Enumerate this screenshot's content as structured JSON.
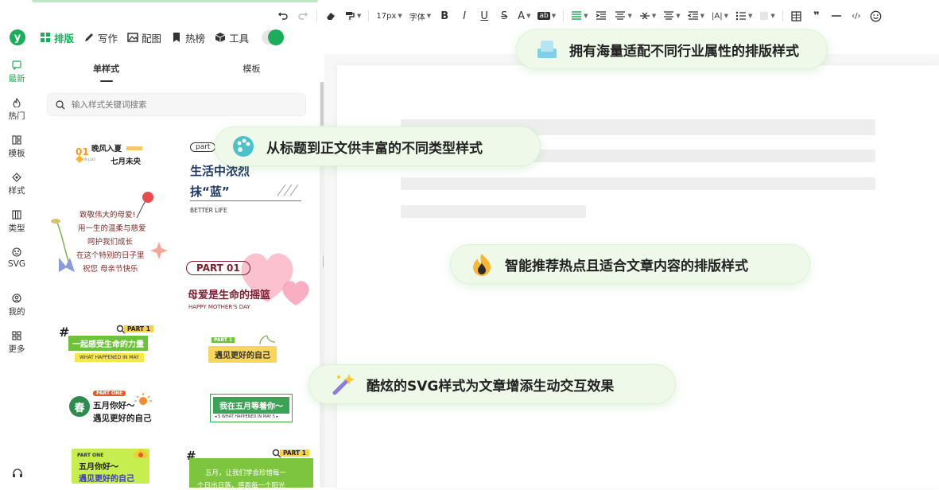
{
  "toolbar": {
    "font_size": "17px",
    "font_family": "字体",
    "bold": "B",
    "italic": "I",
    "underline": "U",
    "strike": "S",
    "font_color": "A",
    "highlight": "ab",
    "letter_spacing": "|A|",
    "quote": "❞",
    "code": "‹/›"
  },
  "main_tabs": [
    {
      "label": "排版"
    },
    {
      "label": "写作"
    },
    {
      "label": "配图"
    },
    {
      "label": "热榜"
    },
    {
      "label": "工具"
    }
  ],
  "rail": [
    {
      "label": "最新"
    },
    {
      "label": "热门"
    },
    {
      "label": "模板"
    },
    {
      "label": "样式"
    },
    {
      "label": "类型"
    },
    {
      "label": "SVG"
    },
    {
      "label": "我的"
    },
    {
      "label": "更多"
    }
  ],
  "panel": {
    "tabs": [
      {
        "label": "单样式"
      },
      {
        "label": "模板"
      }
    ],
    "search_placeholder": "输入样式关键词搜索",
    "styles": {
      "s1": {
        "num": "01",
        "line1": "晚风入夏",
        "line2": "七月未央",
        "tiny": "IN JULY"
      },
      "s2": {
        "tag": "part",
        "line1": "生活中浓烈",
        "line2": "抹“蓝”",
        "sub": "BETTER LIFE"
      },
      "s3": {
        "l1": "致敬伟大的母爱!",
        "l2": "用一生的温柔与慈爱",
        "l3": "呵护我们成长",
        "l4": "在这个特别的日子里",
        "l5": "祝您 母亲节快乐"
      },
      "s4": {
        "tag": "PART 01",
        "title": "母爱是生命的摇篮",
        "sub": "HAPPY MOTHER'S DAY"
      },
      "s5": {
        "hash": "#",
        "tag": "PART 1",
        "title": "一起感受生命的力量",
        "sub": "WHAT HAPPENED IN MAY"
      },
      "s6": {
        "tag": "PART 1",
        "title": "遇见更好的自己"
      },
      "s7": {
        "circle": "春",
        "tag": "PART ONE",
        "l1": "五月你好～",
        "l2": "遇见更好的自己"
      },
      "s8": {
        "title": "我在五月等着你～",
        "sub": "◂ 5 WHAT HAPPENED IN MAY 5 ▸"
      },
      "s9": {
        "tag": "PART ONE",
        "l1": "五月你好～",
        "l2": "遇见更好的自己"
      },
      "s10": {
        "hash": "#",
        "tag": "PART 1",
        "l1": "五月，让我们学会珍惜每一",
        "l2": "个日出日落，感恩每一个阳光"
      }
    }
  },
  "callouts": [
    {
      "text": "拥有海量适配不同行业属性的排版样式"
    },
    {
      "text": "从标题到正文供丰富的不同类型样式"
    },
    {
      "text": "智能推荐热点且适合文章内容的排版样式"
    },
    {
      "text": "酷炫的SVG样式为文章增添生动交互效果"
    }
  ],
  "colors": {
    "brand": "#1aad5a",
    "callout_bg": "#eef9ea"
  }
}
